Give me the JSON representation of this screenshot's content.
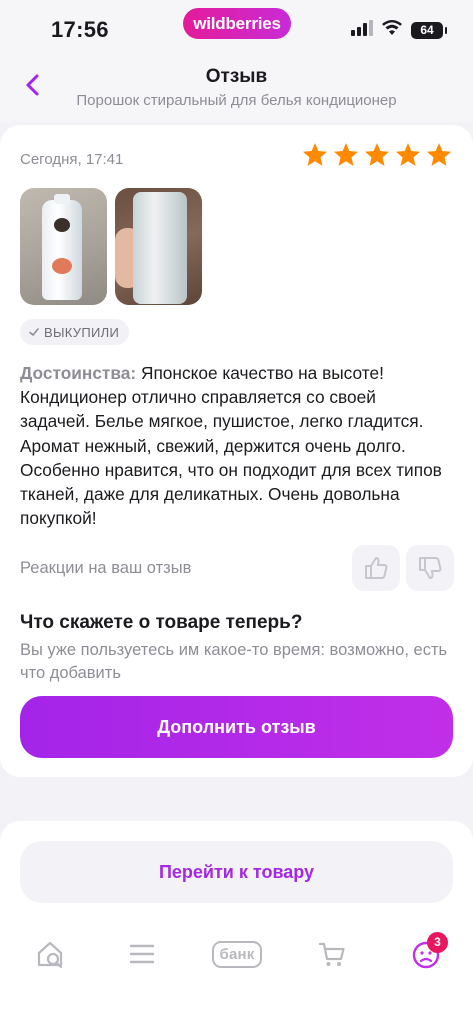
{
  "status_bar": {
    "time": "17:56",
    "brand": "wildberries",
    "battery": "64"
  },
  "header": {
    "title": "Отзыв",
    "subtitle": "Порошок стиральный для белья кондиционер",
    "back_icon": "chevron-left-icon"
  },
  "review": {
    "date": "Сегодня, 17:41",
    "rating": 5,
    "rating_max": 5,
    "star_color": "#ff8a00",
    "photo_count": 2,
    "bought_badge": "ВЫКУПИЛИ",
    "pros_label": "Достоинства:",
    "pros_text": " Японское качество на высоте! Кондиционер отлично справляется со своей задачей. Белье мягкое, пушистое, легко гладится. Аромат нежный, свежий, держится очень долго. Особенно нравится, что он подходит для всех типов тканей, даже для деликатных. Очень довольна покупкой!",
    "reactions_label": "Реакции на ваш отзыв"
  },
  "prompt": {
    "title": "Что скажете о товаре теперь?",
    "subtitle": "Вы уже пользуетесь им какое-то время: возможно, есть что добавить",
    "add_button": "Дополнить отзыв"
  },
  "product": {
    "goto_button": "Перейти к товару"
  },
  "tab_bar": {
    "bank_label": "банк",
    "profile_badge": "3"
  },
  "colors": {
    "accent": "#a324e8",
    "brand_pink": "#e41b9a",
    "badge": "#e8175d"
  }
}
